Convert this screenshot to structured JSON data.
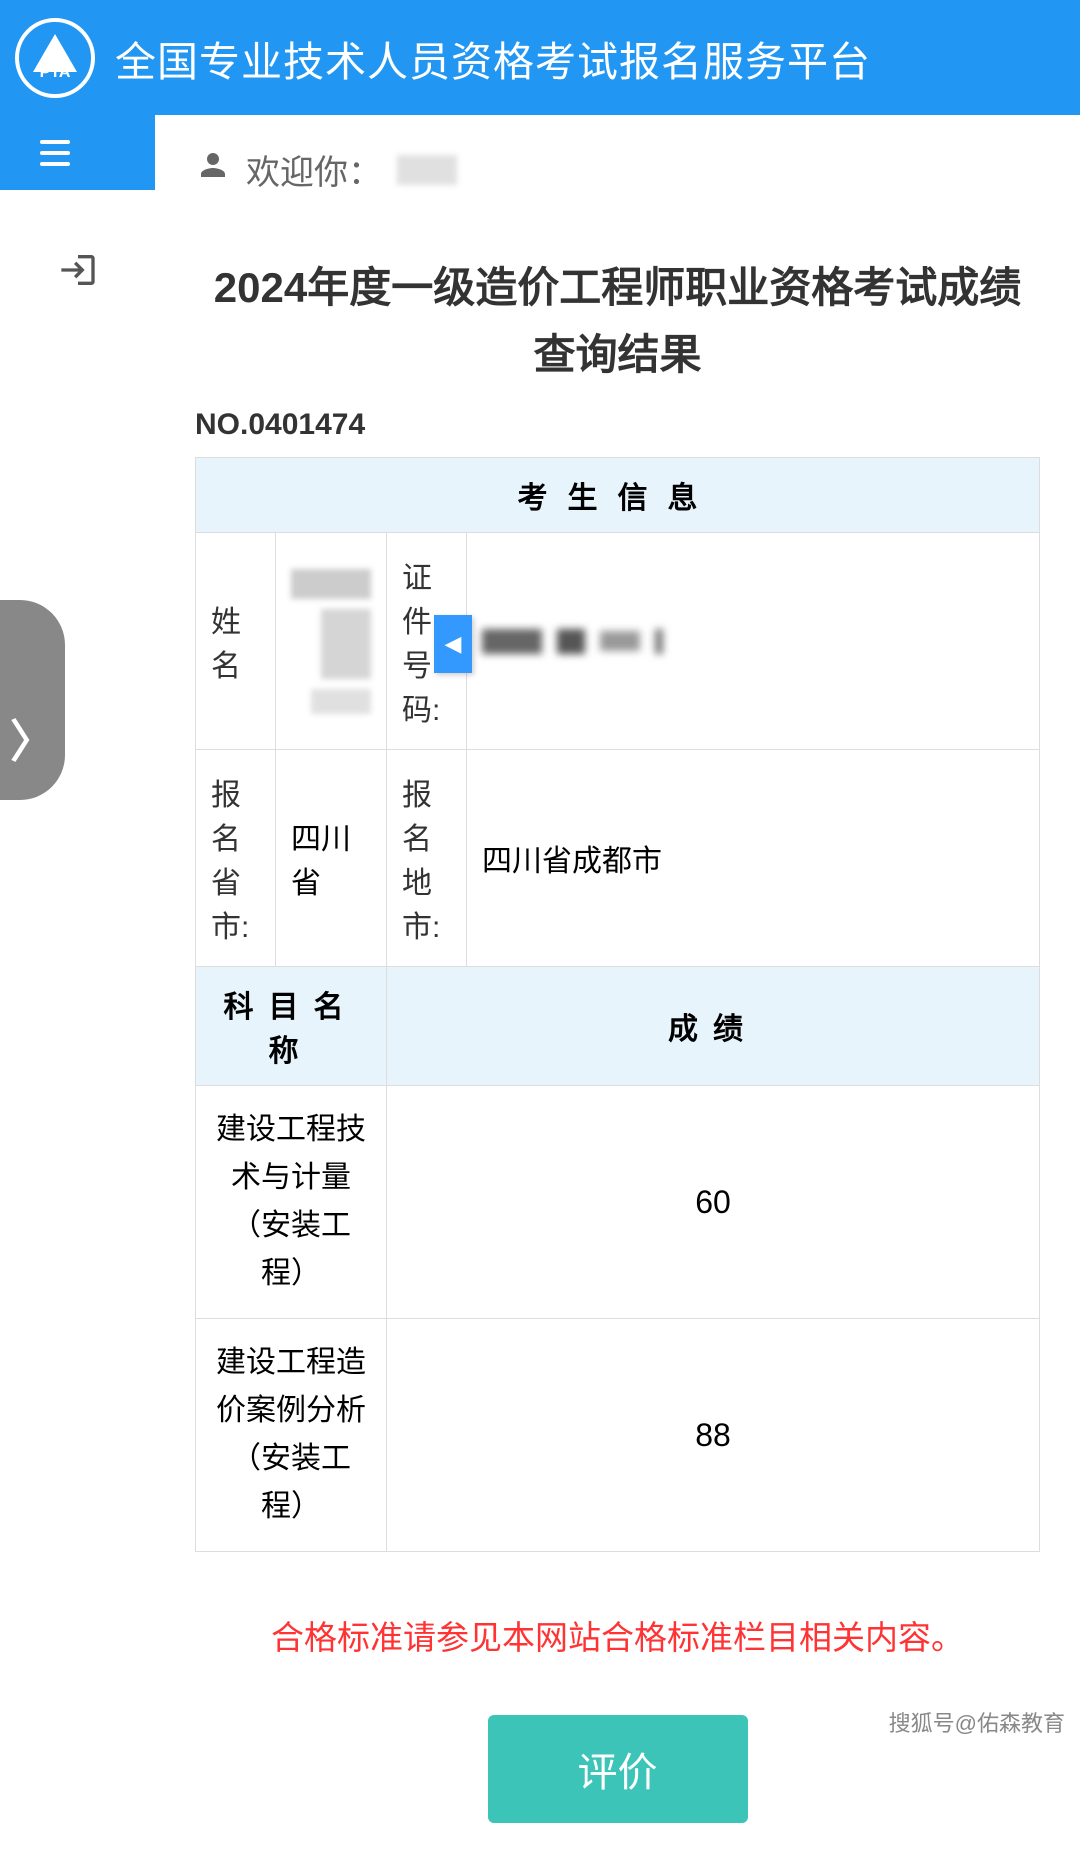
{
  "header": {
    "platform_title": "全国专业技术人员资格考试报名服务平台",
    "logo_text": "PTA"
  },
  "welcome": {
    "prefix": "欢迎你："
  },
  "main": {
    "title": "2024年度一级造价工程师职业资格考试成绩查询结果",
    "record_no": "NO.0401474",
    "candidate_info_header": "考生信息",
    "name_label": "姓名",
    "id_label": "证件号码:",
    "reg_province_label": "报名省市:",
    "reg_province_value": "四川省",
    "reg_city_label": "报名地市:",
    "reg_city_value": "四川省成都市",
    "subject_header": "科目名称",
    "score_header": "成绩",
    "subjects": [
      {
        "name": "建设工程技术与计量（安装工程）",
        "score": "60"
      },
      {
        "name": "建设工程造价案例分析（安装工程）",
        "score": "88"
      }
    ],
    "notice": "合格标准请参见本网站合格标准栏目相关内容。",
    "evaluate_btn": "评价"
  },
  "watermark": "搜狐号@佑森教育"
}
